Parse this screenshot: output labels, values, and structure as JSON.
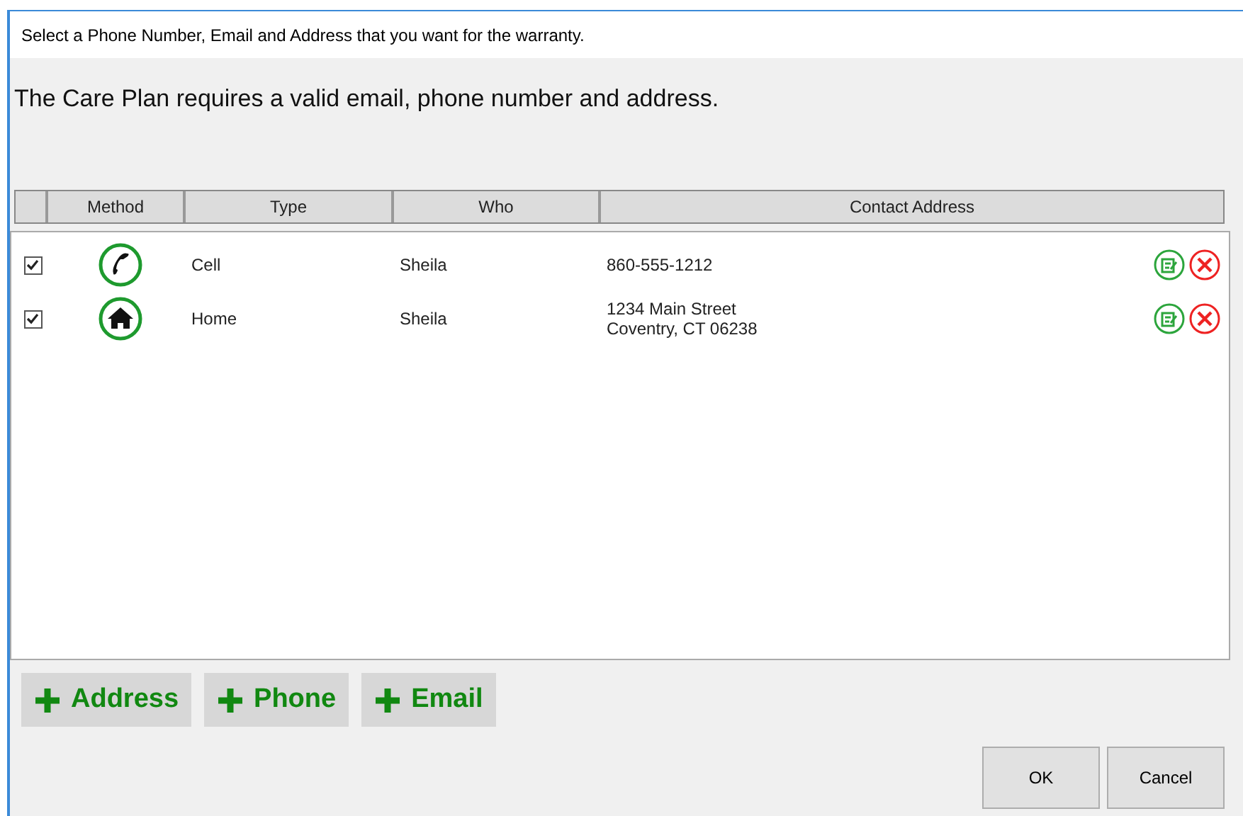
{
  "window": {
    "title": "Select a Phone Number, Email and Address that you want for the warranty."
  },
  "message": "The Care Plan requires a valid email, phone number and address.",
  "table": {
    "columns": [
      "Method",
      "Type",
      "Who",
      "Contact Address"
    ],
    "rows": [
      {
        "checked": true,
        "kind": "phone",
        "type": "Cell",
        "who": "Sheila",
        "contact": [
          "860-555-1212"
        ]
      },
      {
        "checked": true,
        "kind": "home",
        "type": "Home",
        "who": "Sheila",
        "contact": [
          "1234 Main Street",
          "Coventry, CT 06238"
        ]
      }
    ]
  },
  "add_buttons": [
    "Address",
    "Phone",
    "Email"
  ],
  "buttons": [
    "OK",
    "Cancel"
  ]
}
